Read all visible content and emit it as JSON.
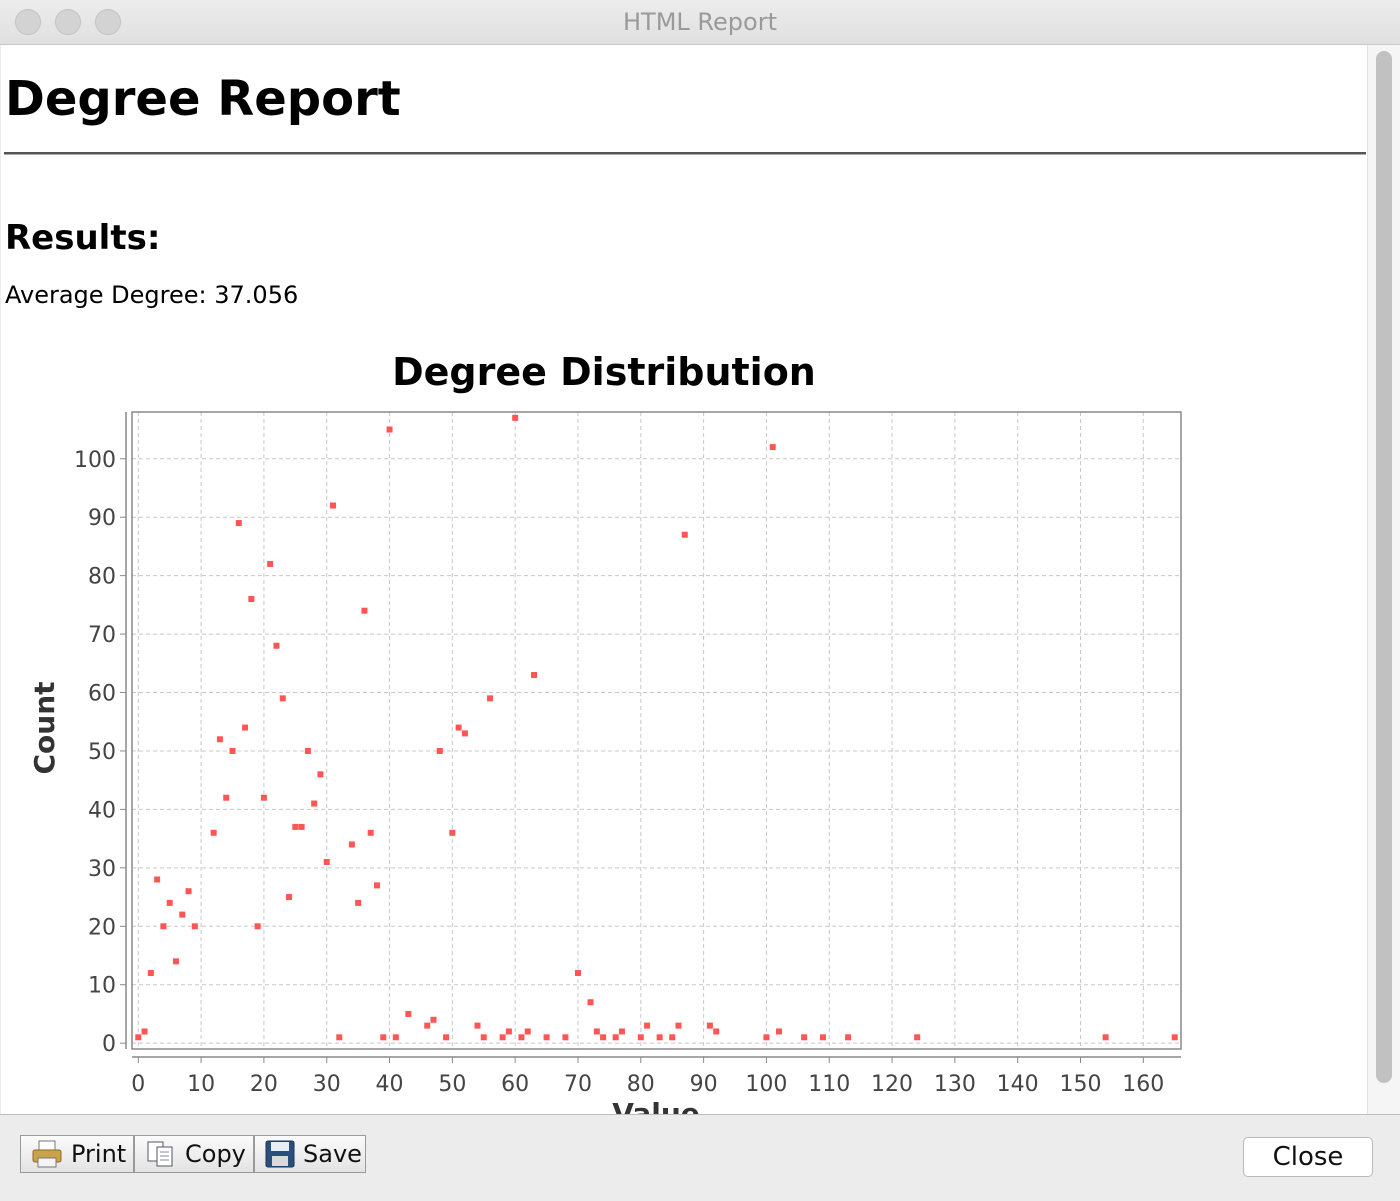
{
  "window": {
    "title": "HTML Report"
  },
  "report": {
    "title": "Degree Report",
    "results_heading": "Results:",
    "average_label": "Average Degree: 37.056"
  },
  "toolbar": {
    "print_label": "Print",
    "copy_label": "Copy",
    "save_label": "Save"
  },
  "close_label": "Close",
  "colors": {
    "point": "#ff5555",
    "grid": "#c8c8c8",
    "axis": "#888888"
  },
  "chart_data": {
    "type": "scatter",
    "title": "Degree Distribution",
    "xlabel": "Value",
    "ylabel": "Count",
    "xlim": [
      -1,
      166
    ],
    "ylim": [
      -1,
      108
    ],
    "xticks": [
      0,
      10,
      20,
      30,
      40,
      50,
      60,
      70,
      80,
      90,
      100,
      110,
      120,
      130,
      140,
      150,
      160
    ],
    "yticks": [
      0,
      10,
      20,
      30,
      40,
      50,
      60,
      70,
      80,
      90,
      100
    ],
    "grid": true,
    "legend": "none",
    "points": [
      [
        0,
        1
      ],
      [
        1,
        2
      ],
      [
        2,
        12
      ],
      [
        3,
        28
      ],
      [
        4,
        20
      ],
      [
        5,
        24
      ],
      [
        6,
        14
      ],
      [
        7,
        22
      ],
      [
        8,
        26
      ],
      [
        9,
        20
      ],
      [
        12,
        36
      ],
      [
        13,
        52
      ],
      [
        14,
        42
      ],
      [
        15,
        50
      ],
      [
        16,
        89
      ],
      [
        17,
        54
      ],
      [
        18,
        76
      ],
      [
        19,
        20
      ],
      [
        20,
        42
      ],
      [
        21,
        82
      ],
      [
        22,
        68
      ],
      [
        23,
        59
      ],
      [
        24,
        25
      ],
      [
        25,
        37
      ],
      [
        26,
        37
      ],
      [
        27,
        50
      ],
      [
        28,
        41
      ],
      [
        29,
        46
      ],
      [
        30,
        31
      ],
      [
        31,
        92
      ],
      [
        32,
        1
      ],
      [
        34,
        34
      ],
      [
        35,
        24
      ],
      [
        36,
        74
      ],
      [
        37,
        36
      ],
      [
        38,
        27
      ],
      [
        39,
        1
      ],
      [
        40,
        105
      ],
      [
        41,
        1
      ],
      [
        43,
        5
      ],
      [
        46,
        3
      ],
      [
        47,
        4
      ],
      [
        48,
        50
      ],
      [
        49,
        1
      ],
      [
        50,
        36
      ],
      [
        51,
        54
      ],
      [
        52,
        53
      ],
      [
        54,
        3
      ],
      [
        55,
        1
      ],
      [
        56,
        59
      ],
      [
        58,
        1
      ],
      [
        59,
        2
      ],
      [
        60,
        107
      ],
      [
        61,
        1
      ],
      [
        62,
        2
      ],
      [
        63,
        63
      ],
      [
        65,
        1
      ],
      [
        68,
        1
      ],
      [
        70,
        12
      ],
      [
        72,
        7
      ],
      [
        73,
        2
      ],
      [
        74,
        1
      ],
      [
        76,
        1
      ],
      [
        77,
        2
      ],
      [
        80,
        1
      ],
      [
        81,
        3
      ],
      [
        83,
        1
      ],
      [
        85,
        1
      ],
      [
        86,
        3
      ],
      [
        87,
        87
      ],
      [
        91,
        3
      ],
      [
        92,
        2
      ],
      [
        100,
        1
      ],
      [
        101,
        102
      ],
      [
        102,
        2
      ],
      [
        106,
        1
      ],
      [
        109,
        1
      ],
      [
        113,
        1
      ],
      [
        124,
        1
      ],
      [
        154,
        1
      ],
      [
        165,
        1
      ]
    ]
  }
}
